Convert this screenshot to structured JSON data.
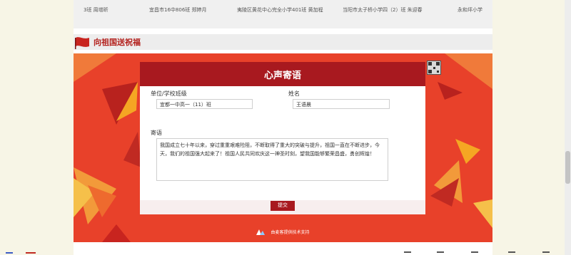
{
  "ticker": {
    "items": [
      "3班 周增昕",
      "宜昌市16中806班 郑婷月",
      "夷陵区黄花中心完全小学401班 黄加程",
      "当阳市太子桥小学四（2）班 朱迎春",
      "永和坪小学"
    ]
  },
  "section": {
    "title": "向祖国送祝福"
  },
  "form": {
    "title": "心声寄语",
    "unit_label": "单位/学校班级",
    "unit_value": "宜都一中高一（11）班",
    "name_label": "姓名",
    "name_value": "王语晨",
    "message_label": "寄语",
    "message_value": "我国成立七十年以来，穿过重重艰难险阻，不断取得了重大的突破与提升，祖国一直在不断进步，今天，我们的祖国强大起来了！祖国人民共同欢庆这一神圣时刻，望我国能够繁荣昌盛，勇创辉煌！",
    "submit_label": "提交"
  },
  "footer": {
    "powered_by": "由麦客提供技术支持"
  },
  "colors": {
    "accent": "#a8191f",
    "banner": "#e8412a",
    "title": "#b3201c"
  }
}
